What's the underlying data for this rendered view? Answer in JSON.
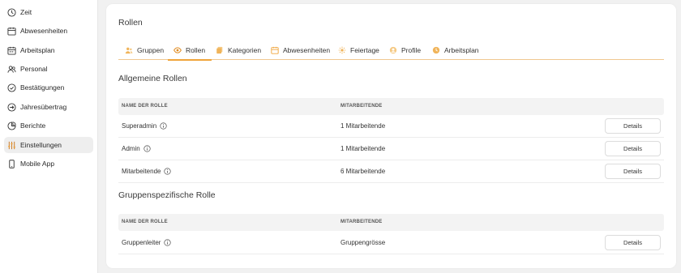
{
  "sidebar": {
    "items": [
      {
        "label": "Zeit",
        "icon": "clock-icon"
      },
      {
        "label": "Abwesenheiten",
        "icon": "calendar-icon"
      },
      {
        "label": "Arbeitsplan",
        "icon": "calendar-plan-icon"
      },
      {
        "label": "Personal",
        "icon": "people-icon"
      },
      {
        "label": "Bestätigungen",
        "icon": "check-circle-icon"
      },
      {
        "label": "Jahresübertrag",
        "icon": "arrow-circle-icon"
      },
      {
        "label": "Berichte",
        "icon": "chart-icon"
      },
      {
        "label": "Einstellungen",
        "icon": "sliders-icon",
        "active": true
      },
      {
        "label": "Mobile App",
        "icon": "phone-icon"
      }
    ]
  },
  "page": {
    "title": "Rollen",
    "tabs": [
      {
        "label": "Gruppen",
        "icon": "group-icon"
      },
      {
        "label": "Rollen",
        "icon": "eye-icon",
        "active": true
      },
      {
        "label": "Kategorien",
        "icon": "folder-icon"
      },
      {
        "label": "Abwesenheiten",
        "icon": "calendar-icon"
      },
      {
        "label": "Feiertage",
        "icon": "sun-icon"
      },
      {
        "label": "Profile",
        "icon": "profile-icon"
      },
      {
        "label": "Arbeitsplan",
        "icon": "clock-icon"
      }
    ]
  },
  "general": {
    "title": "Allgemeine Rollen",
    "col_name": "NAME DER ROLLE",
    "col_count": "MITARBEITENDE",
    "rows": [
      {
        "name": "Superadmin",
        "count": "1 Mitarbeitende",
        "button": "Details"
      },
      {
        "name": "Admin",
        "count": "1 Mitarbeitende",
        "button": "Details"
      },
      {
        "name": "Mitarbeitende",
        "count": "6 Mitarbeitende",
        "button": "Details"
      }
    ]
  },
  "group": {
    "title": "Gruppenspezifische Rolle",
    "col_name": "NAME DER ROLLE",
    "col_count": "MITARBEITENDE",
    "rows": [
      {
        "name": "Gruppenleiter",
        "count": "Gruppengrösse",
        "button": "Details"
      }
    ]
  },
  "colors": {
    "accent": "#f0a43a",
    "tab_underline": "#f0c890",
    "active_bg": "#eeeeee",
    "page_bg": "#f1f1f1"
  }
}
